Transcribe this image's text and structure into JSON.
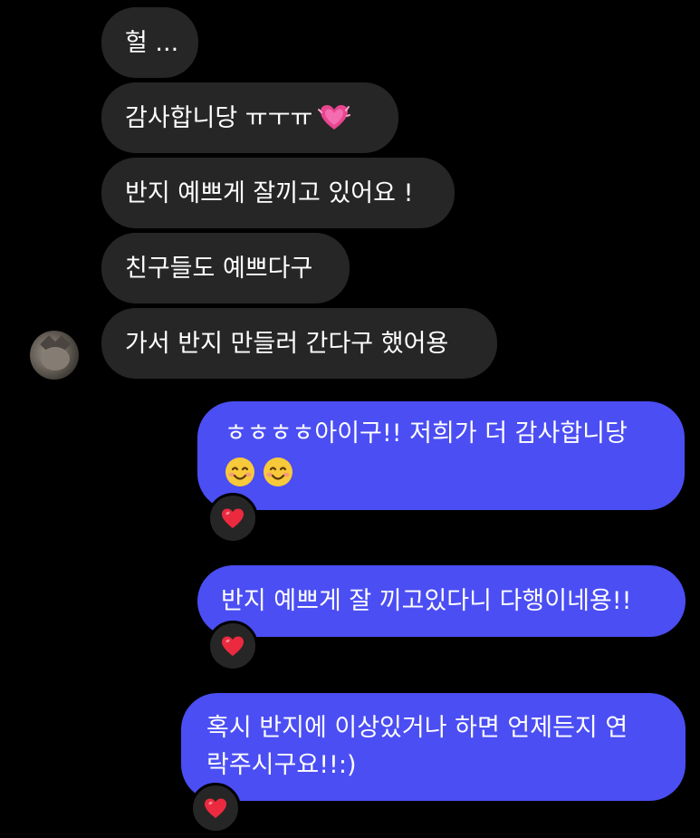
{
  "incoming": [
    {
      "text": "헐 ..."
    },
    {
      "text": "감사합니당 ㅠㅜㅠ",
      "emoji": "sparkling-heart"
    },
    {
      "text": "반지 예쁘게 잘끼고 있어요 !"
    },
    {
      "text": "친구들도 예쁘다구"
    },
    {
      "text": "가서 반지 만들러 간다구 했어용"
    }
  ],
  "outgoing": [
    {
      "line1": "ㅎㅎㅎㅎ아이구!! 저희가 더 감사합니당",
      "emojis": [
        "smiling-face",
        "smiling-face"
      ],
      "reaction": "red-heart"
    },
    {
      "line1": "반지 예쁘게 잘 끼고있다니 다행이네용!!",
      "reaction": "red-heart"
    },
    {
      "line1": "혹시 반지에 이상있거나 하면 언제든지 연",
      "line2": "락주시구요!!:)",
      "reaction": "red-heart"
    }
  ],
  "colors": {
    "background": "#000000",
    "incoming_bubble": "#262626",
    "outgoing_bubble": "#4b4ef3",
    "text": "#ffffff"
  }
}
